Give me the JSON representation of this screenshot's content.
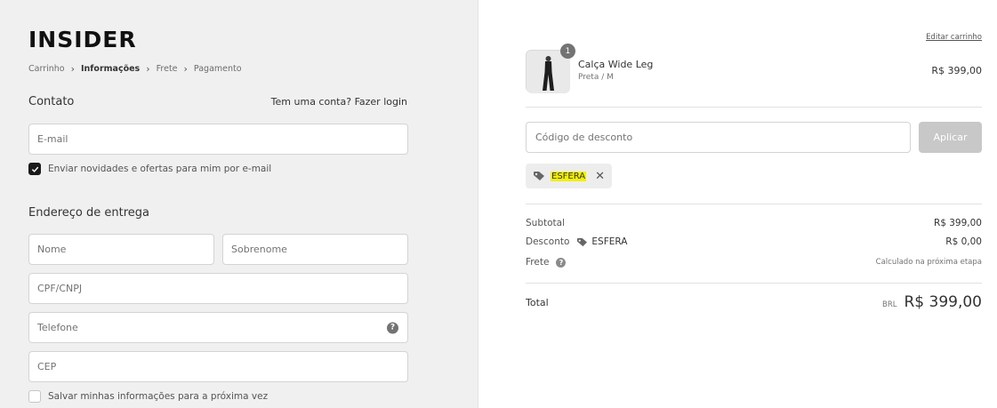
{
  "brand": {
    "logo_text": "INSIDER"
  },
  "breadcrumb": {
    "items": [
      "Carrinho",
      "Informações",
      "Frete",
      "Pagamento"
    ],
    "active_index": 1
  },
  "contact": {
    "title": "Contato",
    "login_prompt": "Tem uma conta?",
    "login_link": "Fazer login",
    "email_placeholder": "E-mail",
    "newsletter_label": "Enviar novidades e ofertas para mim por e-mail",
    "newsletter_checked": true
  },
  "shipping": {
    "title": "Endereço de entrega",
    "first_name_placeholder": "Nome",
    "last_name_placeholder": "Sobrenome",
    "cpf_placeholder": "CPF/CNPJ",
    "phone_placeholder": "Telefone",
    "cep_placeholder": "CEP",
    "save_info_label": "Salvar minhas informações para a próxima vez",
    "save_info_checked": false
  },
  "cart": {
    "edit_link": "Editar carrinho",
    "product": {
      "name": "Calça Wide Leg",
      "variant": "Preta / M",
      "price": "R$ 399,00",
      "quantity": "1"
    },
    "discount": {
      "placeholder": "Código de desconto",
      "apply_label": "Aplicar",
      "applied_code": "ESFERA"
    },
    "summary": {
      "subtotal_label": "Subtotal",
      "subtotal_value": "R$ 399,00",
      "discount_label": "Desconto",
      "discount_code": "ESFERA",
      "discount_value": "R$ 0,00",
      "shipping_label": "Frete",
      "shipping_value": "Calculado na próxima etapa",
      "total_label": "Total",
      "currency": "BRL",
      "total_value": "R$ 399,00"
    }
  },
  "colors": {
    "left_bg": "#f0f0f0",
    "highlight": "#f3f000",
    "apply_disabled": "#c8c8c8"
  }
}
